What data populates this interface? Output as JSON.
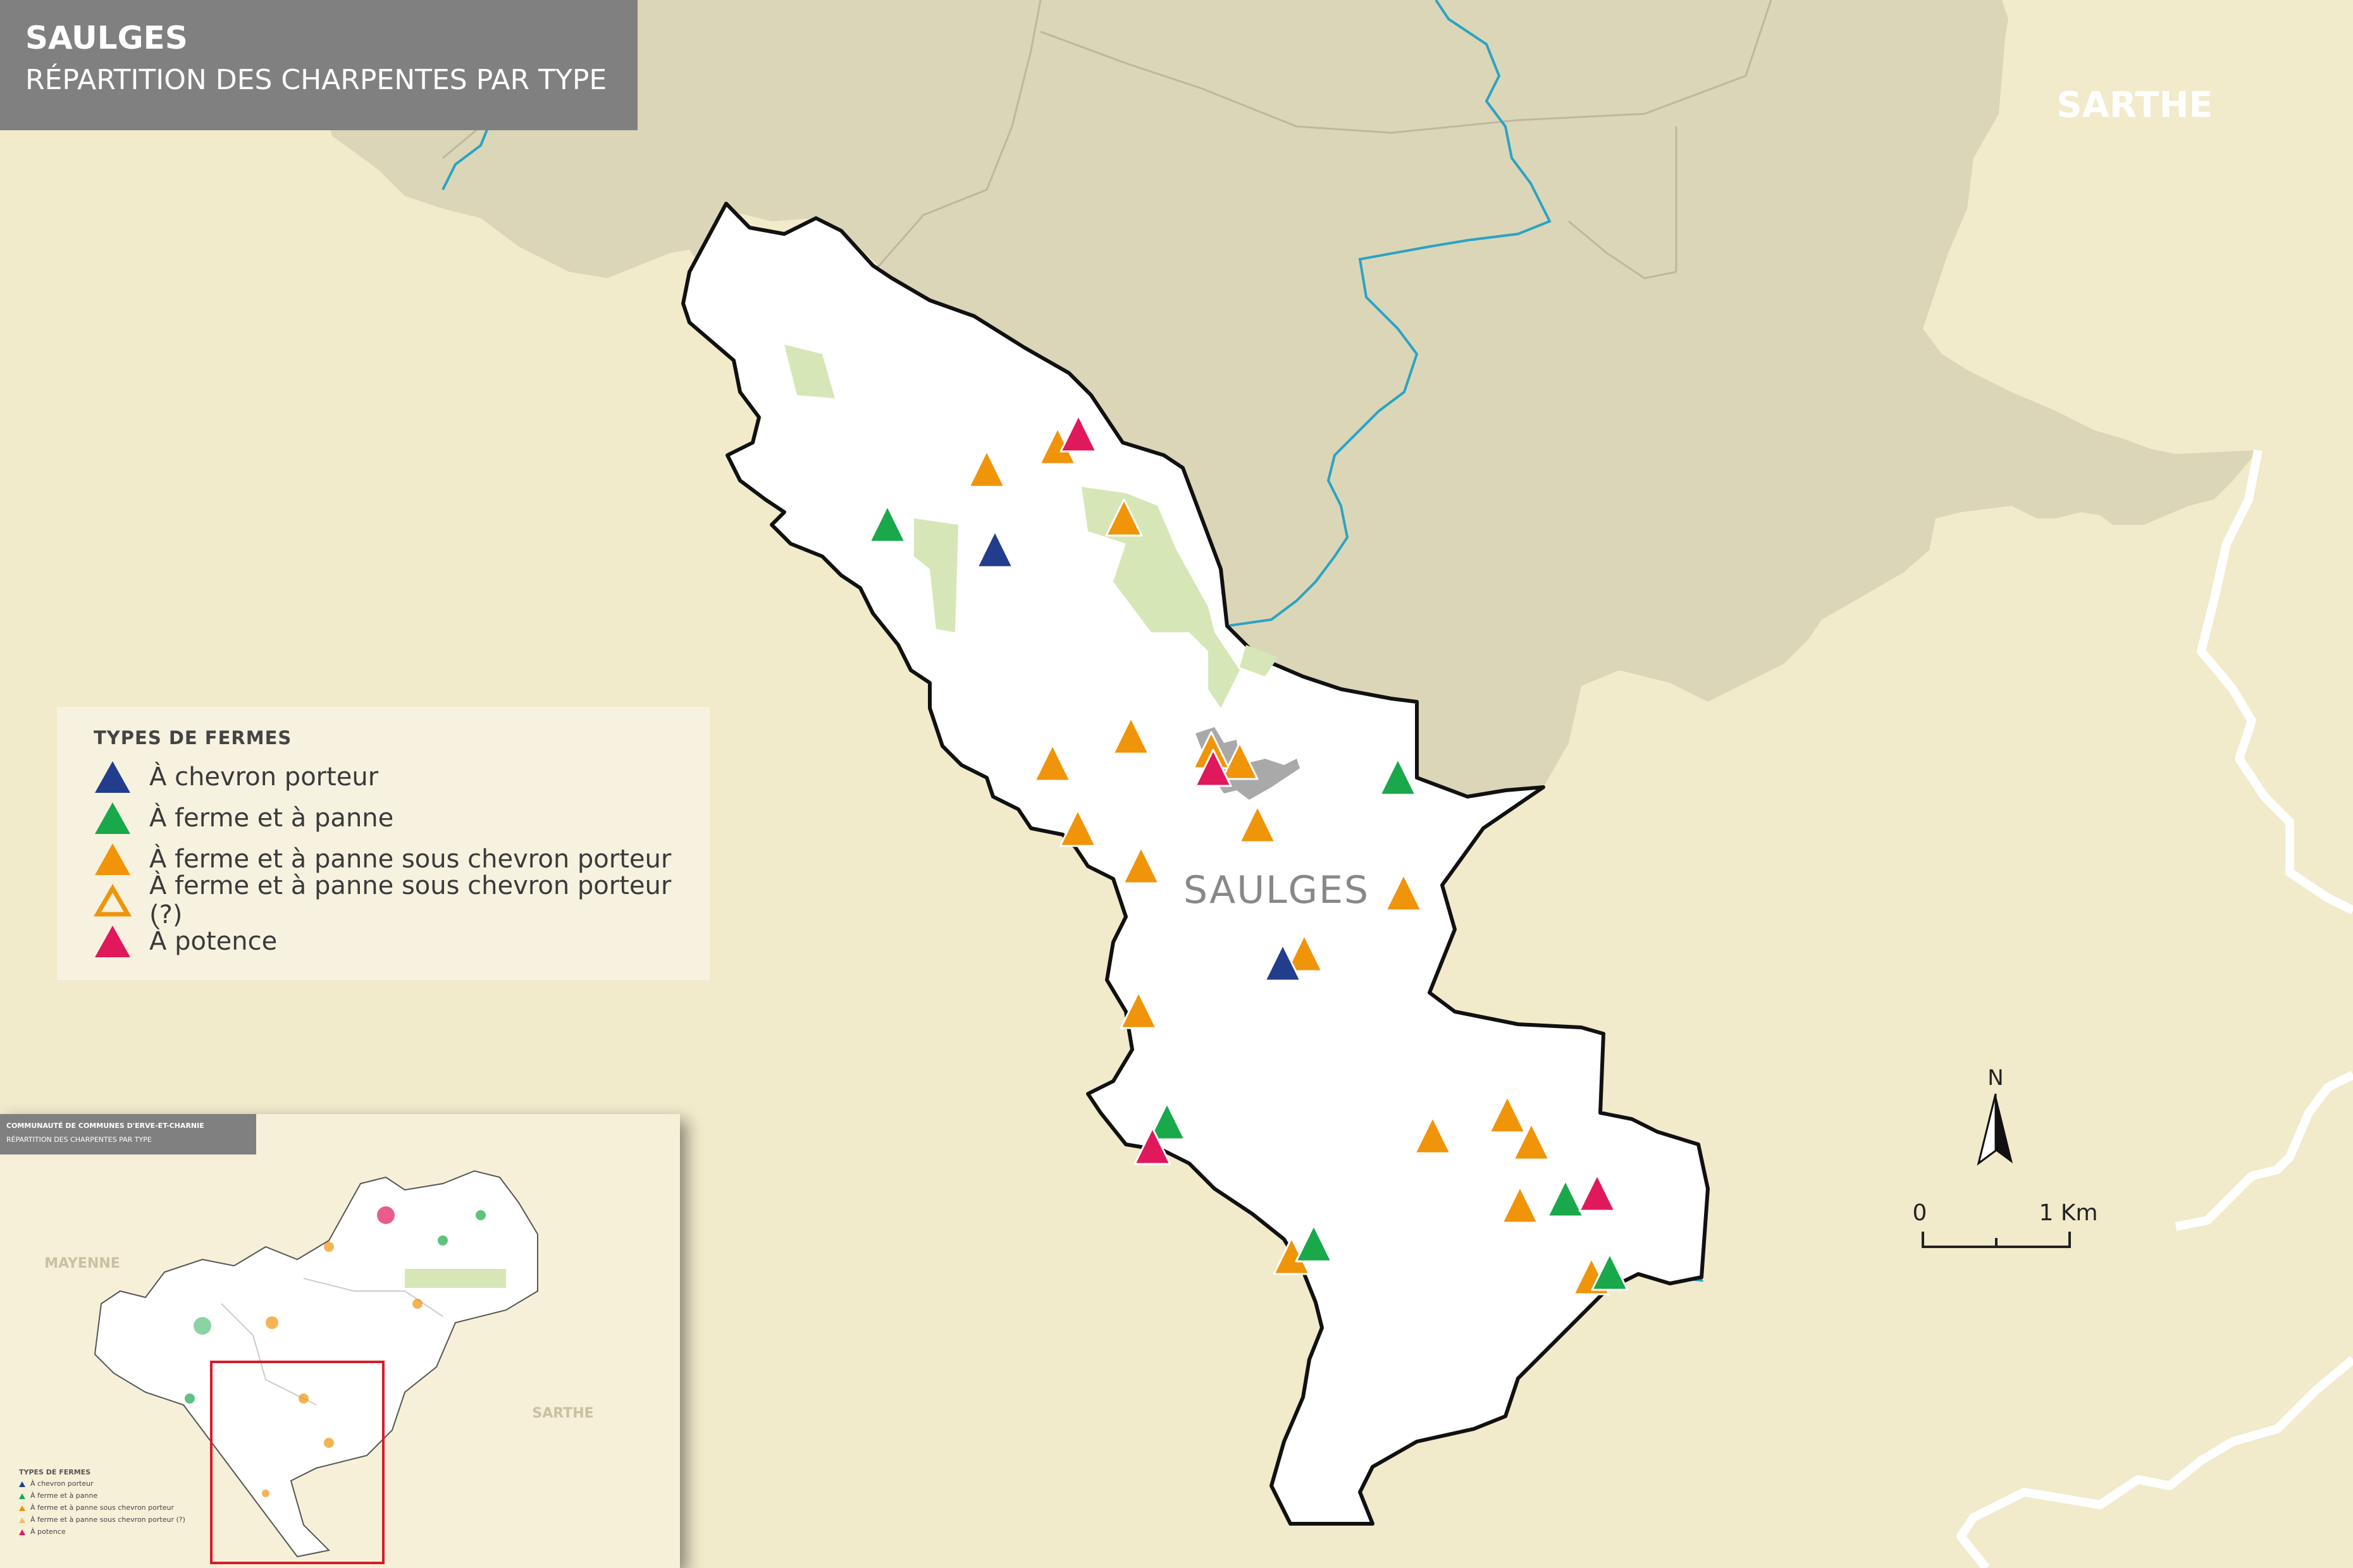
{
  "title": {
    "name": "SAULGES",
    "subtitle": "RÉPARTITION DES CHARPENTES PAR TYPE"
  },
  "map_labels": {
    "sarthe": "SARTHE",
    "commune": "SAULGES"
  },
  "legend": {
    "heading": "TYPES DE FERMES",
    "items": [
      {
        "label": "À chevron porteur",
        "color": "#213d8c",
        "style": "filled"
      },
      {
        "label": "À ferme et à panne",
        "color": "#19a84a",
        "style": "filled"
      },
      {
        "label": "À ferme et à panne sous chevron porteur",
        "color": "#f0940a",
        "style": "filled"
      },
      {
        "label": "À ferme et à panne sous chevron porteur (?)",
        "color": "#f0940a",
        "style": "outline"
      },
      {
        "label": "À potence",
        "color": "#e0185c",
        "style": "filled"
      }
    ]
  },
  "scale": {
    "north": "N",
    "zero": "0",
    "one": "1 Km"
  },
  "inset": {
    "header_title": "COMMUNAUTÉ DE COMMUNES D'ERVE-ET-CHARNIE",
    "header_subtitle": "RÉPARTITION DES CHARPENTES PAR TYPE",
    "label_mayenne": "MAYENNE",
    "label_sarthe": "SARTHE",
    "legend_heading": "TYPES DE FERMES",
    "legend_items": [
      "À chevron porteur",
      "À ferme et à panne",
      "À ferme et à panne sous chevron porteur",
      "À ferme et à panne sous chevron porteur (?)",
      "À potence"
    ]
  },
  "colors": {
    "background": "#f1eacb",
    "neighbor_area": "#dbd6b8",
    "commune_fill": "#ffffff",
    "border": "#111111",
    "river": "#2ba3c4",
    "forest": "#d7e6b6",
    "urban": "#a9a9a9"
  }
}
